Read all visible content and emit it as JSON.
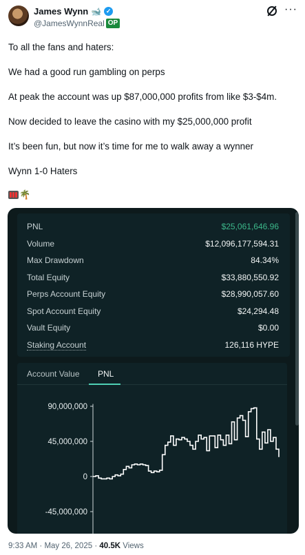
{
  "header": {
    "display_name": "James Wynn",
    "name_emoji": "🐋",
    "handle": "@JamesWynnReal",
    "op_badge": "OP"
  },
  "post": {
    "lines": [
      "To all the fans and haters:",
      "We had a good run gambling on perps",
      "At peak the account was up $87,000,000 profits from like $3-$4m.",
      "Now decided to leave the casino with my $25,000,000 profit",
      "It’s been fun, but now it’s time for me to walk away a wynner",
      "Wynn 1-0 Haters"
    ],
    "emoji_palm": "🌴"
  },
  "stats": [
    {
      "label": "PNL",
      "value": "$25,061,646.96"
    },
    {
      "label": "Volume",
      "value": "$12,096,177,594.31"
    },
    {
      "label": "Max Drawdown",
      "value": "84.34%"
    },
    {
      "label": "Total Equity",
      "value": "$33,880,550.92"
    },
    {
      "label": "Perps Account Equity",
      "value": "$28,990,057.60"
    },
    {
      "label": "Spot Account Equity",
      "value": "$24,294.48"
    },
    {
      "label": "Vault Equity",
      "value": "$0.00"
    },
    {
      "label": "Staking Account",
      "value": "126,116 HYPE"
    }
  ],
  "colors": {
    "pnl_green": "#3cb88a",
    "card_bg": "#0d1a1c",
    "tab_accent": "#4fd1b5"
  },
  "tabs": [
    {
      "label": "Account Value"
    },
    {
      "label": "PNL"
    }
  ],
  "chart_data": {
    "type": "line",
    "series_step": true,
    "y_ticks": [
      "90,000,000",
      "45,000,000",
      "0",
      "-45,000,000"
    ],
    "y_tick_values": [
      90000000,
      45000000,
      0,
      -45000000
    ],
    "ylim": [
      -45000000,
      100000000
    ],
    "y": [
      0,
      1000000,
      -2000000,
      -3000000,
      -3000000,
      -2000000,
      -3000000,
      0,
      2000000,
      1000000,
      3000000,
      9000000,
      13000000,
      11000000,
      15000000,
      16000000,
      15000000,
      16000000,
      15000000,
      14000000,
      7000000,
      5000000,
      7000000,
      6000000,
      8000000,
      28000000,
      40000000,
      44000000,
      52000000,
      40000000,
      48000000,
      47000000,
      50000000,
      48000000,
      45000000,
      40000000,
      35000000,
      45000000,
      53000000,
      48000000,
      50000000,
      33000000,
      52000000,
      52000000,
      37000000,
      53000000,
      47000000,
      40000000,
      53000000,
      42000000,
      70000000,
      47000000,
      75000000,
      78000000,
      72000000,
      51000000,
      83000000,
      87000000,
      88000000,
      48000000,
      35000000,
      57000000,
      43000000,
      60000000,
      45000000,
      50000000,
      35000000,
      25000000
    ]
  },
  "meta": {
    "time": "9:33 AM",
    "date": "May 26, 2025",
    "views_count": "40.5K",
    "views_label": "Views"
  }
}
